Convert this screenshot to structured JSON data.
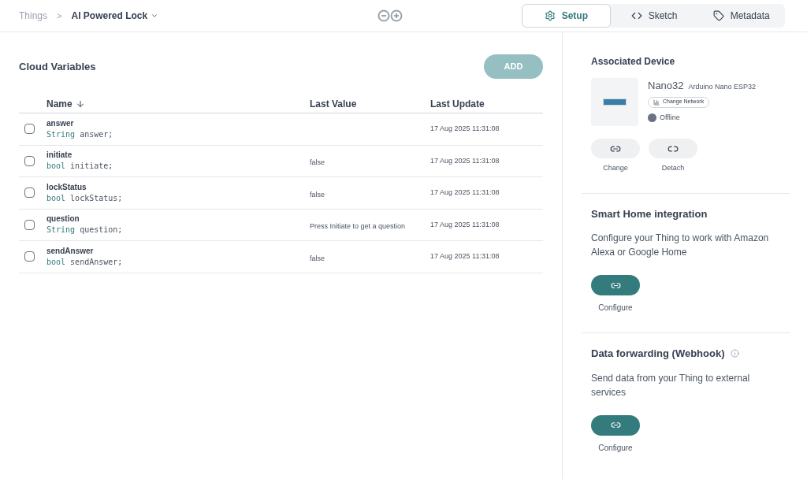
{
  "breadcrumb": {
    "parent": "Things",
    "separator": ">",
    "current": "AI Powered Lock"
  },
  "tabs": [
    {
      "label": "Setup",
      "kind": "gear",
      "selected": true
    },
    {
      "label": "Sketch",
      "kind": "code",
      "selected": false
    },
    {
      "label": "Metadata",
      "kind": "tag",
      "selected": false
    }
  ],
  "variables": {
    "title": "Cloud Variables",
    "add_button": {
      "label": "ADD",
      "disabled": true
    },
    "columns": [
      "Name",
      "Last Value",
      "Last Update"
    ],
    "rows": [
      {
        "name": "answer",
        "type": "String",
        "declaration": "answer;",
        "last_value": "",
        "last_update": "17 Aug 2025 11:31:08",
        "checked": false
      },
      {
        "name": "initiate",
        "type": "bool",
        "declaration": "initiate;",
        "last_value": "false",
        "last_update": "17 Aug 2025 11:31:08",
        "checked": false
      },
      {
        "name": "lockStatus",
        "type": "bool",
        "declaration": "lockStatus;",
        "last_value": "false",
        "last_update": "17 Aug 2025 11:31:08",
        "checked": false
      },
      {
        "name": "question",
        "type": "String",
        "declaration": "question;",
        "last_value": "Press Initiate to get a question",
        "last_update": "17 Aug 2025 11:31:08",
        "checked": false
      },
      {
        "name": "sendAnswer",
        "type": "bool",
        "declaration": "sendAnswer;",
        "last_value": "false",
        "last_update": "17 Aug 2025 11:31:08",
        "checked": false
      }
    ]
  },
  "device": {
    "title": "Associated Device",
    "name": "Nano32",
    "model": "Arduino Nano ESP32",
    "network_button": "Change Network",
    "status": "Offline",
    "online": false,
    "actions": [
      {
        "label": "Change",
        "kind": "link"
      },
      {
        "label": "Detach",
        "kind": "unlink"
      }
    ]
  },
  "smart_home": {
    "title": "Smart Home integration",
    "description": "Configure your Thing to work with Amazon Alexa or Google Home",
    "button": "Configure"
  },
  "webhook": {
    "title": "Data forwarding (Webhook)",
    "description": "Send data from your Thing to external services",
    "button": "Configure"
  }
}
